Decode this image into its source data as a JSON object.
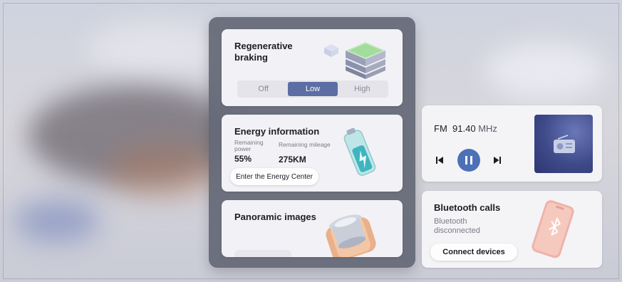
{
  "regen": {
    "title": "Regenerative braking",
    "options": [
      "Off",
      "Low",
      "High"
    ],
    "selected": "Low"
  },
  "energy": {
    "title": "Energy information",
    "power_label": "Remaining power",
    "power_value": "55%",
    "mileage_label": "Remaining mileage",
    "mileage_value": "275KM",
    "button": "Enter the Energy Center"
  },
  "panoramic": {
    "title": "Panoramic images"
  },
  "radio": {
    "band": "FM",
    "frequency": "91.40",
    "unit": "MHz",
    "icons": [
      "skip-previous-icon",
      "pause-icon",
      "skip-next-icon",
      "radio-icon"
    ]
  },
  "bluetooth": {
    "title": "Bluetooth calls",
    "status": "Bluetooth disconnected",
    "button": "Connect devices"
  },
  "colors": {
    "accent": "#5c6ea3",
    "play": "#4c71b8",
    "panel": "#64687a"
  }
}
